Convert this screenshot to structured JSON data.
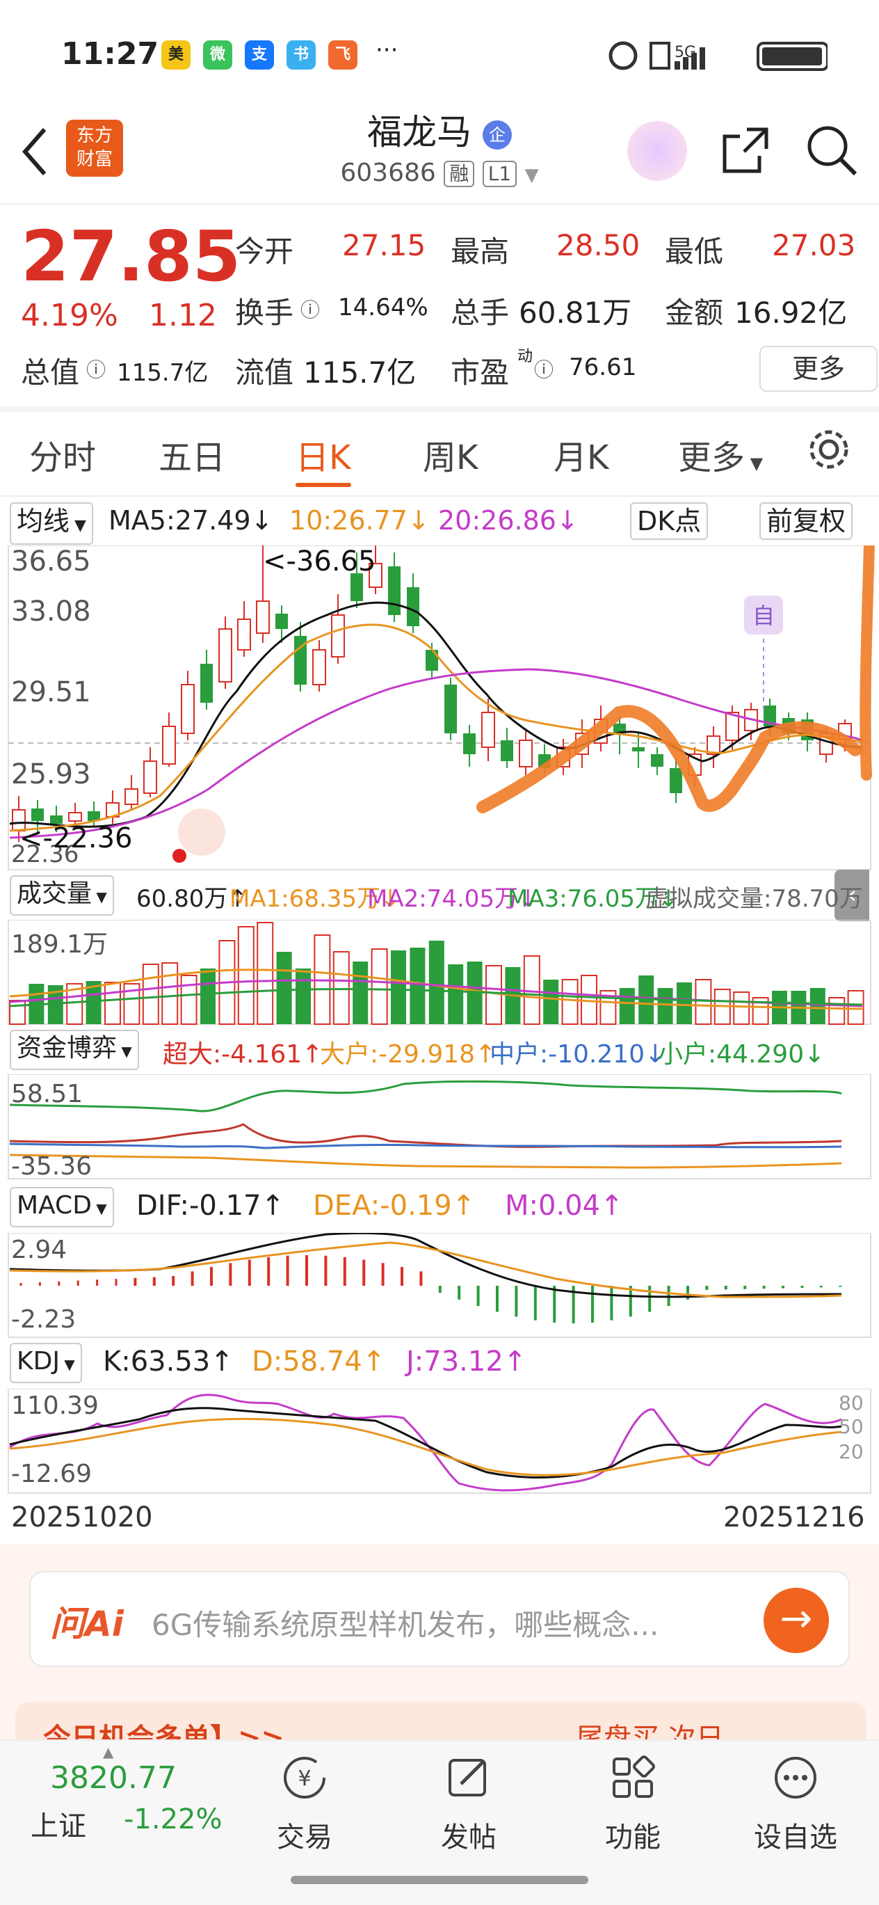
{
  "status": {
    "time": "11:27",
    "app_icons": [
      "美团",
      "微",
      "支",
      "书",
      "飞"
    ],
    "more": "···",
    "signal": "5G"
  },
  "header": {
    "title": "福龙马",
    "code": "603686",
    "tag_rong": "融",
    "tag_l1": "L1",
    "enterprise_mark": "企",
    "brand": "东方\n财富"
  },
  "quote": {
    "price": "27.85",
    "pct": "4.19%",
    "chg": "1.12",
    "open_label": "今开",
    "open": "27.15",
    "high_label": "最高",
    "high": "28.50",
    "low_label": "最低",
    "low": "27.03",
    "turnover_label": "换手",
    "turnover": "14.64%",
    "volume_label": "总手",
    "volume": "60.81万",
    "amount_label": "金额",
    "amount": "16.92亿",
    "mktcap_label": "总值",
    "mktcap": "115.7亿",
    "float_label": "流值",
    "float": "115.7亿",
    "pe_label": "市盈",
    "pe_sup": "动",
    "pe": "76.61",
    "more": "更多"
  },
  "tabs": [
    "分时",
    "五日",
    "日K",
    "周K",
    "月K",
    "更多"
  ],
  "active_tab": "日K",
  "ma_row": {
    "select": "均线",
    "ma5": "MA5:27.49↓",
    "ma10": "10:26.77↓",
    "ma20": "20:26.86↓",
    "dk": "DK点",
    "adjust": "前复权"
  },
  "price_axis": {
    "top": "36.65",
    "l2": "33.08",
    "l3": "29.51",
    "l4": "25.93",
    "bottom": "22.36"
  },
  "annotations": {
    "high_mark": "<-36.65",
    "low_mark": "<-22.36",
    "self_tag": "自"
  },
  "volume_row": {
    "select": "成交量",
    "vol": "60.80万↑",
    "ma1": "MA1:68.35万↓",
    "ma2": "MA2:74.05万↓",
    "ma3": "MA3:76.05万↓",
    "virtual": "虚拟成交量:78.70万",
    "axis_top": "189.1万"
  },
  "fund_row": {
    "select": "资金博弈",
    "super": "超大:-4.161↑",
    "large": "大户:-29.918↑",
    "mid": "中户:-10.210↓",
    "small": "小户:44.290↓",
    "axis_top": "58.51",
    "axis_bottom": "-35.36"
  },
  "macd_row": {
    "select": "MACD",
    "dif": "DIF:-0.17↑",
    "dea": "DEA:-0.19↑",
    "m": "M:0.04↑",
    "axis_top": "2.94",
    "axis_bottom": "-2.23"
  },
  "kdj_row": {
    "select": "KDJ",
    "k": "K:63.53↑",
    "d": "D:58.74↑",
    "j": "J:73.12↑",
    "axis_top": "110.39",
    "axis_bottom": "-12.69",
    "r80": "80",
    "r50": "50",
    "r20": "20"
  },
  "dates": {
    "start": "20251020",
    "end": "20251216"
  },
  "ai": {
    "logo": "问Ai",
    "placeholder": "6G传输系统原型样机发布，哪些概念..."
  },
  "promo": {
    "left": "今日机会多单】>>",
    "right": "尾盘买 次日"
  },
  "bottom": {
    "index_value": "3820.77",
    "index_name": "上证",
    "index_pct": "-1.22%",
    "nav": [
      "交易",
      "发帖",
      "功能",
      "设自选"
    ]
  },
  "colors": {
    "up": "#d93025",
    "down": "#2a9d3c",
    "accent": "#e85a1a",
    "ma10": "#e89420",
    "ma20": "#c43bc9"
  }
}
